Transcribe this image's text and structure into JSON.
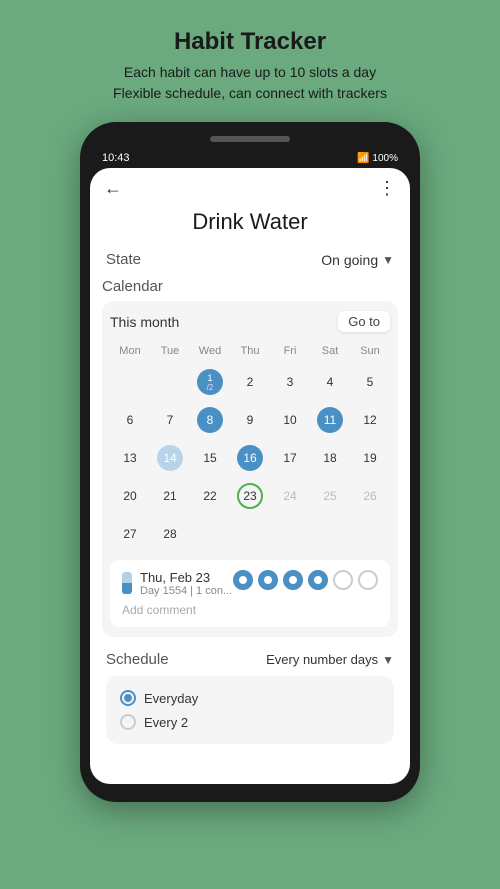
{
  "header": {
    "title": "Habit Tracker",
    "subtitle1": "Each habit can have up to 10 slots a day",
    "subtitle2": "Flexible schedule, can connect with trackers"
  },
  "statusBar": {
    "time": "10:43",
    "battery": "100%"
  },
  "screen": {
    "habitTitle": "Drink Water",
    "stateLabel": "State",
    "stateValue": "On going",
    "calendarLabel": "Calendar",
    "thisMonth": "This month",
    "goTo": "Go to",
    "dayHeaders": [
      "Mon",
      "Tue",
      "Wed",
      "Thu",
      "Fri",
      "Sat",
      "Sun"
    ],
    "calRows": [
      [
        "",
        "",
        "1/2",
        "2",
        "3",
        "4",
        "5"
      ],
      [
        "6",
        "7",
        "8",
        "9",
        "10",
        "11",
        "12"
      ],
      [
        "13",
        "14",
        "15",
        "16",
        "17",
        "18",
        "19"
      ],
      [
        "20",
        "21",
        "22",
        "23",
        "24",
        "25",
        "26"
      ],
      [
        "27",
        "28",
        "",
        "",
        "",
        "",
        ""
      ]
    ],
    "calStyles": [
      [
        "empty",
        "empty",
        "filled-dark",
        "plain",
        "plain",
        "plain",
        "plain"
      ],
      [
        "plain",
        "plain",
        "filled-dark",
        "plain",
        "plain",
        "filled-dark",
        "plain"
      ],
      [
        "plain",
        "filled-light",
        "plain",
        "filled-dark",
        "plain",
        "plain",
        "plain"
      ],
      [
        "plain",
        "plain",
        "plain",
        "today-outline",
        "grey",
        "grey",
        "grey"
      ],
      [
        "plain",
        "plain",
        "empty",
        "empty",
        "empty",
        "empty",
        "empty"
      ]
    ],
    "dayDetail": {
      "date": "Thu, Feb 23",
      "sub": "Day 1554 | 1 con...",
      "slots": [
        "filled",
        "filled",
        "filled",
        "filled",
        "empty",
        "empty"
      ],
      "addComment": "Add comment"
    },
    "scheduleLabel": "Schedule",
    "scheduleValue": "Every number days",
    "options": [
      {
        "label": "Everyday",
        "selected": true
      },
      {
        "label": "Every  2",
        "selected": false
      }
    ]
  }
}
